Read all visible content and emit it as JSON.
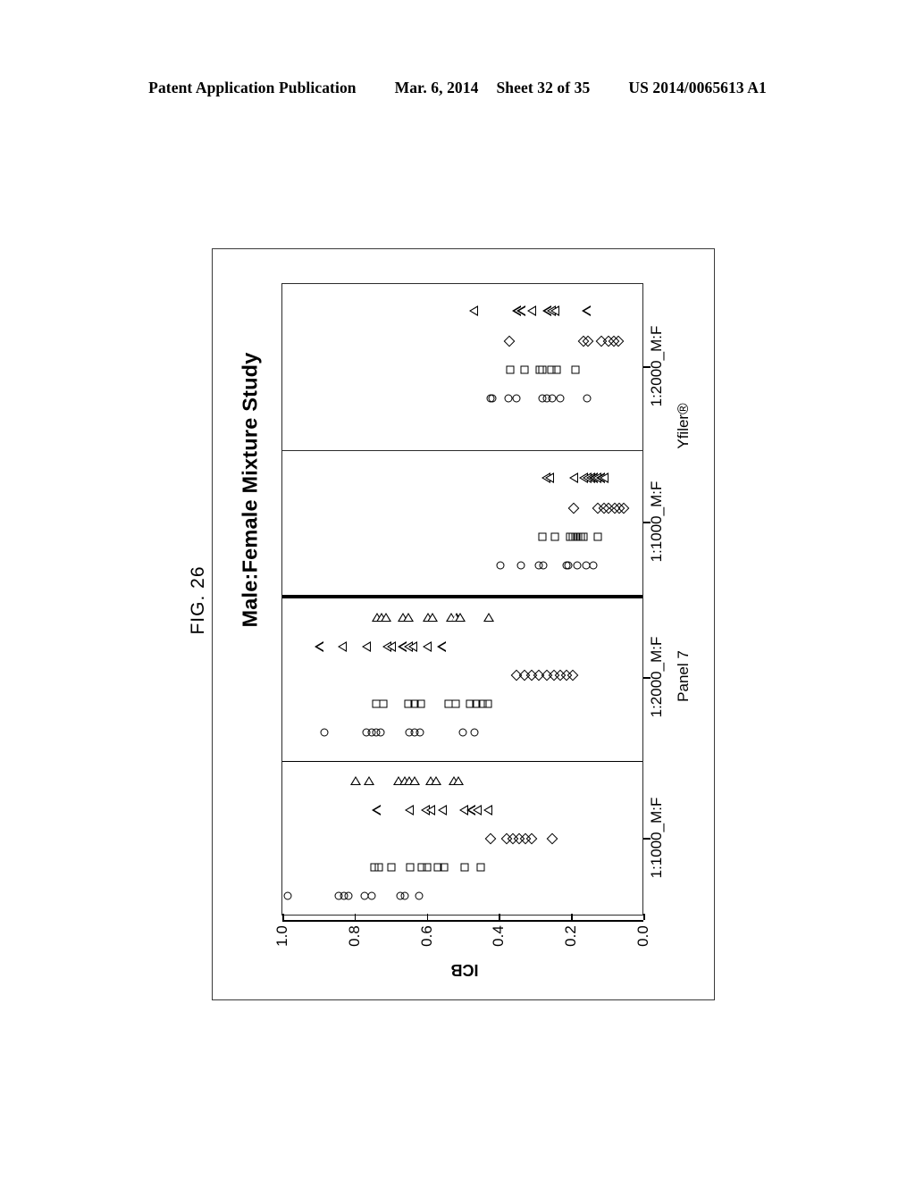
{
  "patent_header": {
    "publication": "Patent Application Publication",
    "date": "Mar. 6, 2014",
    "sheet": "Sheet 32 of 35",
    "number": "US 2014/0065613 A1"
  },
  "figure": {
    "label": "FIG. 26"
  },
  "chart_data": {
    "type": "scatter",
    "title": "Male:Female Mixture Study",
    "xlabel": "",
    "ylabel": "ICB",
    "orientation": "horizontal-strip",
    "ylim": [
      0.0,
      1.0
    ],
    "ytick_labels": [
      "1.0",
      "0.8",
      "0.6",
      "0.4",
      "0.2",
      "0.0"
    ],
    "ytick_values": [
      1.0,
      0.8,
      0.6,
      0.4,
      0.2,
      0.0
    ],
    "grid": false,
    "legend_position": "none",
    "group_labels": [
      "Panel 7",
      "Yfiler®"
    ],
    "categories": [
      "1:1000_M:F",
      "1:2000_M:F",
      "1:1000_M:F",
      "1:2000_M:F"
    ],
    "panels": [
      {
        "id": "panel-p7-1000",
        "group": "Panel 7",
        "category": "1:1000_M:F",
        "series": [
          {
            "name": "circle",
            "marker": "circle",
            "values": [
              0.985,
              0.845,
              0.83,
              0.818,
              0.772,
              0.752,
              0.675,
              0.662,
              0.622
            ]
          },
          {
            "name": "square",
            "marker": "square",
            "values": [
              0.745,
              0.733,
              0.7,
              0.648,
              0.615,
              0.6,
              0.57,
              0.552,
              0.497,
              0.452
            ]
          },
          {
            "name": "diamond",
            "marker": "diamond",
            "values": [
              0.425,
              0.38,
              0.363,
              0.345,
              0.328,
              0.31,
              0.255
            ]
          },
          {
            "name": "left-triangle",
            "marker": "ltriangle",
            "values": [
              0.74,
              0.65,
              0.605,
              0.59,
              0.558,
              0.5,
              0.478,
              0.462,
              0.432
            ]
          },
          {
            "name": "up-triangle",
            "marker": "utriangle",
            "values": [
              0.8,
              0.762,
              0.682,
              0.665,
              0.652,
              0.638,
              0.592,
              0.578,
              0.528,
              0.515
            ]
          }
        ]
      },
      {
        "id": "panel-p7-2000",
        "group": "Panel 7",
        "category": "1:2000_M:F",
        "series": [
          {
            "name": "circle",
            "marker": "circle",
            "values": [
              0.885,
              0.768,
              0.752,
              0.74,
              0.728,
              0.65,
              0.635,
              0.62,
              0.502,
              0.468
            ]
          },
          {
            "name": "square",
            "marker": "square",
            "values": [
              0.74,
              0.722,
              0.652,
              0.635,
              0.618,
              0.54,
              0.522,
              0.482,
              0.465,
              0.448,
              0.432
            ]
          },
          {
            "name": "diamond",
            "marker": "diamond",
            "values": [
              0.352,
              0.33,
              0.312,
              0.292,
              0.268,
              0.25,
              0.232,
              0.215,
              0.198
            ]
          },
          {
            "name": "left-triangle",
            "marker": "ltriangle",
            "values": [
              0.898,
              0.835,
              0.768,
              0.712,
              0.7,
              0.668,
              0.652,
              0.64,
              0.6,
              0.56
            ]
          },
          {
            "name": "up-triangle",
            "marker": "utriangle",
            "values": [
              0.74,
              0.728,
              0.715,
              0.668,
              0.655,
              0.6,
              0.588,
              0.535,
              0.522,
              0.51,
              0.432
            ]
          }
        ]
      },
      {
        "id": "panel-yfiler-1000",
        "group": "Yfiler®",
        "category": "1:1000_M:F",
        "series": [
          {
            "name": "circle",
            "marker": "circle",
            "values": [
              0.398,
              0.34,
              0.292,
              0.278,
              0.215,
              0.21,
              0.185,
              0.16,
              0.14
            ]
          },
          {
            "name": "square",
            "marker": "square",
            "values": [
              0.282,
              0.248,
              0.205,
              0.198,
              0.19,
              0.182,
              0.175,
              0.168,
              0.128
            ]
          },
          {
            "name": "diamond",
            "marker": "diamond",
            "values": [
              0.195,
              0.128,
              0.112,
              0.098,
              0.082,
              0.07,
              0.058
            ]
          },
          {
            "name": "left-triangle",
            "marker": "ltriangle",
            "values": [
              0.272,
              0.262,
              0.195,
              0.168,
              0.158,
              0.148,
              0.14,
              0.132,
              0.12,
              0.112
            ]
          }
        ]
      },
      {
        "id": "panel-yfiler-2000",
        "group": "Yfiler®",
        "category": "1:2000_M:F",
        "series": [
          {
            "name": "circle",
            "marker": "circle",
            "values": [
              0.425,
              0.42,
              0.375,
              0.352,
              0.282,
              0.268,
              0.255,
              0.232,
              0.158
            ]
          },
          {
            "name": "square",
            "marker": "square",
            "values": [
              0.37,
              0.33,
              0.288,
              0.282,
              0.258,
              0.242,
              0.19
            ]
          },
          {
            "name": "diamond",
            "marker": "diamond",
            "values": [
              0.372,
              0.168,
              0.155,
              0.118,
              0.1,
              0.085,
              0.072
            ]
          },
          {
            "name": "left-triangle",
            "marker": "ltriangle",
            "values": [
              0.472,
              0.352,
              0.34,
              0.312,
              0.268,
              0.258,
              0.248,
              0.16
            ]
          }
        ]
      }
    ]
  }
}
